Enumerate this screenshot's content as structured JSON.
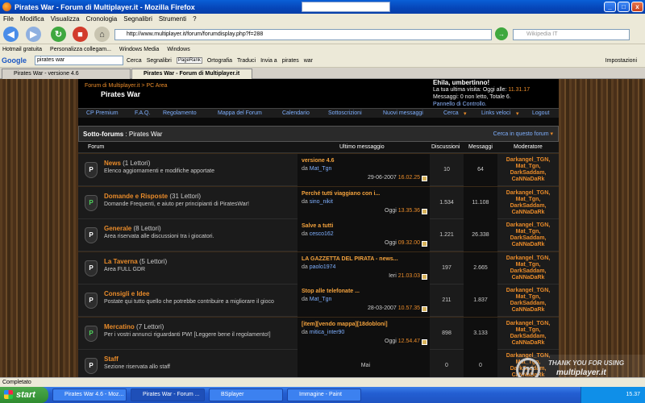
{
  "window": {
    "title": "Pirates War - Forum di Multiplayer.it - Mozilla Firefox",
    "min": "_",
    "max": "□",
    "close": "x"
  },
  "menu": [
    "File",
    "Modifica",
    "Visualizza",
    "Cronologia",
    "Segnalibri",
    "Strumenti",
    "?"
  ],
  "nav": {
    "url": "http://www.multiplayer.it/forum/forumdisplay.php?f=288",
    "search_placeholder": "Wikipedia IT"
  },
  "bookmarks": [
    "Hotmail gratuita",
    "Personalizza collegam...",
    "Windows Media",
    "Windows"
  ],
  "google": {
    "logo": "Google",
    "query": "pirates war",
    "cerca": "Cerca",
    "segnalibri": "Segnalibri",
    "pagerank": "PageRank",
    "ortografia": "Ortografia",
    "traduci": "Traduci",
    "invia": "Invia a",
    "w1": "pirates",
    "w2": "war",
    "impostazioni": "Impostazioni"
  },
  "tabs": [
    "Pirates War - versione 4.6",
    "Pirates War - Forum di Multiplayer.it"
  ],
  "header": {
    "breadcrumb": "Forum di Multiplayer.it > PC Area",
    "forum_name": "Pirates War",
    "user_name": "Ehila, umbertinno!",
    "last_visit": "La tua ultima visita: Oggi alle:",
    "last_visit_time": "11.31.17",
    "messages": "Messaggi: 0 non letto, Totale 6.",
    "panel": "Pannello di Controllo."
  },
  "navlinks": [
    "CP Premium",
    "F.A.Q.",
    "Regolamento",
    "Mappa del Forum",
    "Calendario",
    "Sottoscrizioni",
    "Nuovi messaggi",
    "Cerca",
    "Links veloci",
    "Logout"
  ],
  "subforums": {
    "title": "Sotto-forums",
    "forum": ": Pirates War",
    "search": "Cerca in questo forum"
  },
  "columns": [
    "Forum",
    "Ultimo messaggio",
    "Discussioni",
    "Messaggi",
    "Moderatore"
  ],
  "rows": [
    {
      "icon": "P",
      "name": "News",
      "readers": "(1 Lettori)",
      "desc": "Elenco aggiornamenti e modifiche apportate",
      "last_title": "versione 4.6",
      "last_by": "Mat_Tgn",
      "last_date": "29-06-2007",
      "last_time": "16.02.25",
      "threads": "10",
      "posts": "64"
    },
    {
      "icon": "P",
      "name": "Domande e Risposte",
      "readers": "(31 Lettori)",
      "desc": "Domande Frequenti, e aiuto per principianti di PiratesWar!",
      "last_title": "Perché tutti viaggiano con i...",
      "last_by": "sino_nikit",
      "last_date": "Oggi",
      "last_time": "13.35.36",
      "threads": "1.534",
      "posts": "11.108"
    },
    {
      "icon": "P",
      "name": "Generale",
      "readers": "(8 Lettori)",
      "desc": "Area riservata alle discussioni tra i giocatori.",
      "last_title": "Salve a tutti",
      "last_by": "cesco162",
      "last_date": "Oggi",
      "last_time": "09.32.00",
      "threads": "1.221",
      "posts": "26.338"
    },
    {
      "icon": "P",
      "name": "La Taverna",
      "readers": "(5 Lettori)",
      "desc": "Area FULL GDR",
      "last_title": "LA GAZZETTA DEL PIRATA - news...",
      "last_by": "paolo1974",
      "last_date": "Ieri",
      "last_time": "21.03.03",
      "threads": "197",
      "posts": "2.665"
    },
    {
      "icon": "P",
      "name": "Consigli e Idee",
      "readers": "",
      "desc": "Postate qui tutto quello che potrebbe contribuire a migliorare il gioco",
      "last_title": "Stop alle telefonate ...",
      "last_by": "Mat_Tgn",
      "last_date": "28-03-2007",
      "last_time": "10.57.35",
      "threads": "211",
      "posts": "1.837"
    },
    {
      "icon": "P",
      "name": "Mercatino",
      "readers": "(7 Lettori)",
      "desc": "Per i vostri annunci riguardanti PW! [Leggere bene il regolamento!]",
      "last_title": "[item][vendo mappa][18dobloni]",
      "last_by": "mitica_inter90",
      "last_date": "Oggi",
      "last_time": "12.54.47",
      "threads": "898",
      "posts": "3.133"
    },
    {
      "icon": "P",
      "name": "Staff",
      "readers": "",
      "desc": "Sezione riservata allo staff",
      "last_title": "",
      "last_by": "",
      "last_date": "Mai",
      "last_time": "",
      "threads": "0",
      "posts": "0"
    }
  ],
  "moderators": "Darkangel_TGN, Mat_Tgn, DarkSaddam, CaNNaDaRk",
  "status": "Completato",
  "taskbar": {
    "start": "start",
    "items": [
      "Pirates War 4.6 - Moz...",
      "Pirates War - Forum ...",
      "BSplayer",
      "Immagine - Paint"
    ],
    "clock": "15.37"
  },
  "watermark": {
    "l1": "THANK YOU FOR USING",
    "l2": "multiplayer.it"
  }
}
